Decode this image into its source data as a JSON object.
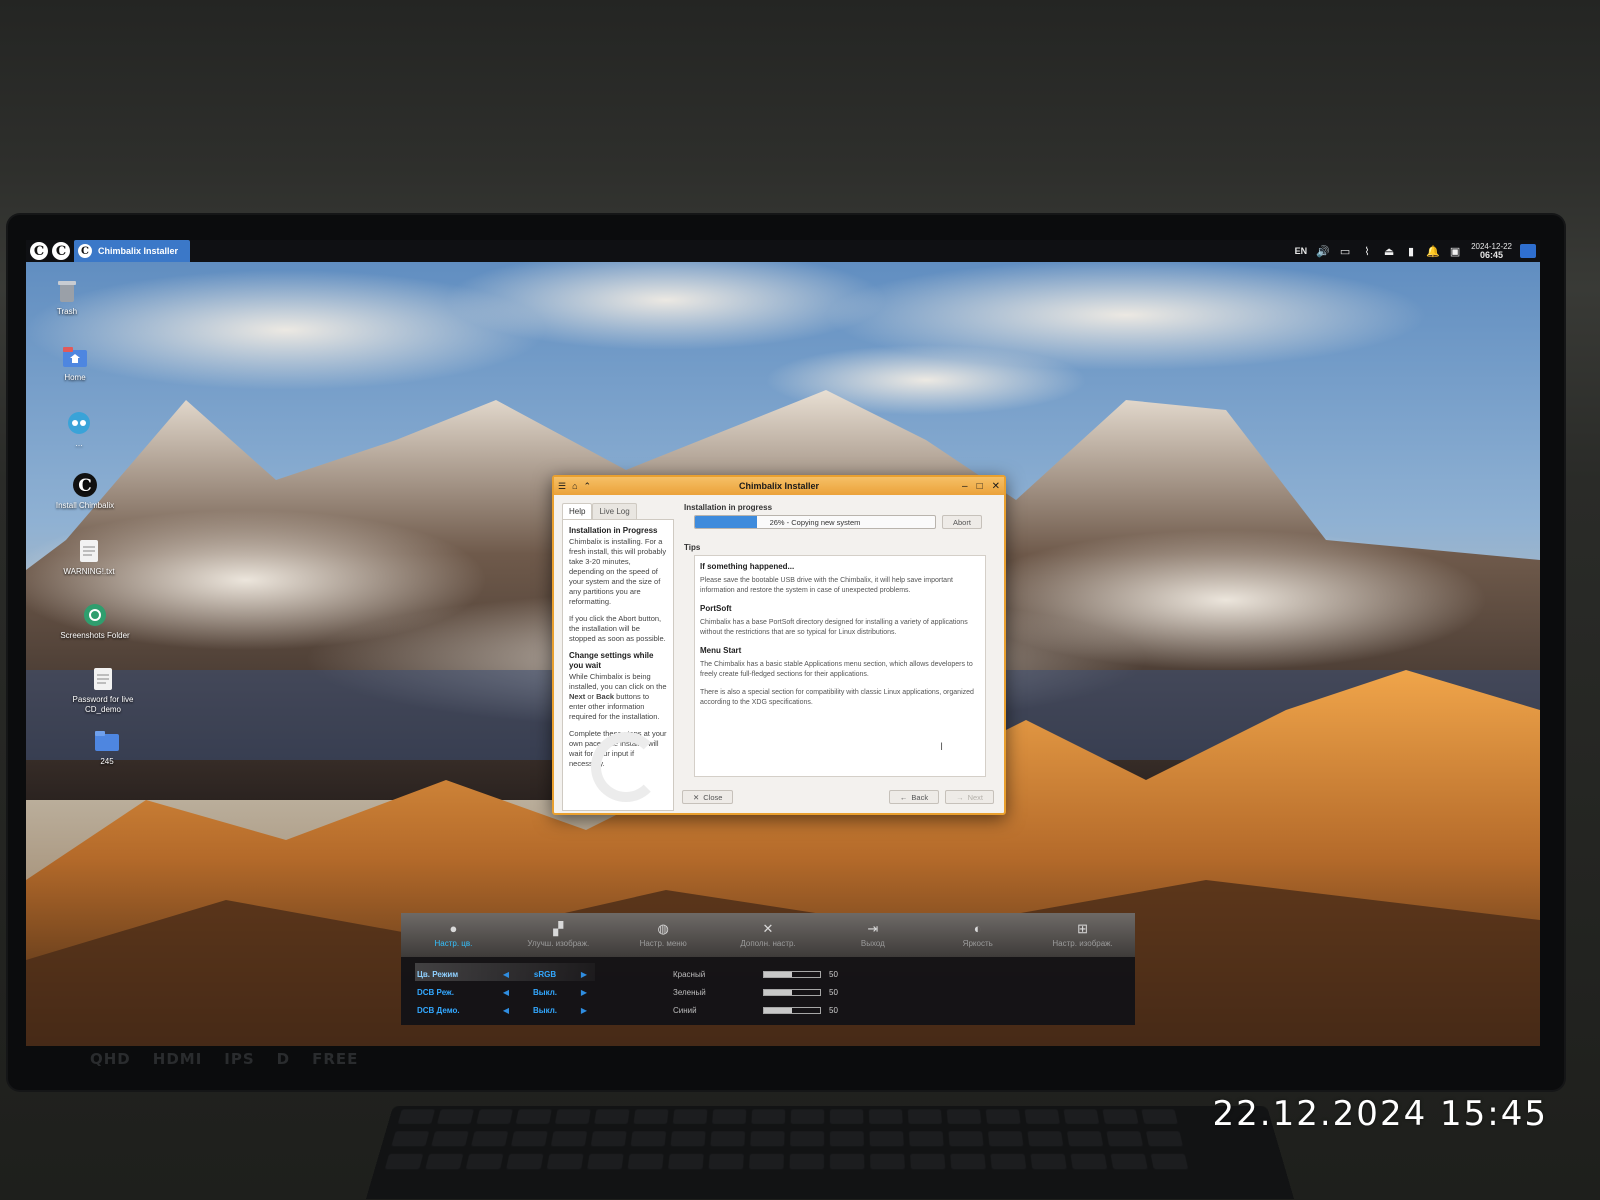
{
  "taskbar": {
    "active_window_label": "Chimbalix Installer",
    "tray": {
      "language": "EN",
      "date": "2024-12-22",
      "time": "06:45",
      "icons": [
        "volume-icon",
        "display-icon",
        "clip-icon",
        "eject-icon",
        "battery-icon",
        "notification-bell-icon",
        "screen-icon"
      ]
    }
  },
  "desktop_icons": [
    {
      "name": "trash-icon",
      "label": "Trash"
    },
    {
      "name": "home-folder-icon",
      "label": "Home"
    },
    {
      "name": "…"
    },
    {
      "name": "chimbalix-logo-icon",
      "label": "Install Chimbalix"
    },
    {
      "name": "document-icon",
      "label": "WARNING!.txt"
    },
    {
      "name": "screenshots-icon",
      "label": "Screenshots Folder"
    },
    {
      "name": "document-icon",
      "label": "Password for live CD_demo"
    },
    {
      "name": "folder-icon",
      "label": "245"
    }
  ],
  "installer": {
    "title": "Chimbalix Installer",
    "tabs": [
      "Help",
      "Live Log"
    ],
    "active_tab": "Help",
    "help": {
      "heading_1": "Installation in Progress",
      "para_1": "Chimbalix is installing. For a fresh install, this will probably take 3-20 minutes, depending on the speed of your system and the size of any partitions you are reformatting.",
      "para_2": "If you click the Abort button, the installation will be stopped as soon as possible.",
      "heading_2": "Change settings while you wait",
      "para_3a": "While Chimbalix is being installed, you can click on the",
      "para_3_next": "Next",
      "para_3_or": "or",
      "para_3_back": "Back",
      "para_3b": "buttons to enter other information required for the installation.",
      "para_4": "Complete these steps at your own pace. The installer will wait for your input if necessary."
    },
    "progress": {
      "label": "Installation in progress",
      "percent": 26,
      "text": "26% - Copying new system",
      "abort_label": "Abort"
    },
    "tips": {
      "label": "Tips",
      "h1": "If something happened...",
      "p1": "Please save the bootable USB drive with the Chimbalix, it will help save important information and restore the system in case of unexpected problems.",
      "h2": "PortSoft",
      "p2": "Chimbalix has a base PortSoft directory designed for installing a variety of applications without the restrictions that are so typical for Linux distributions.",
      "h3": "Menu Start",
      "p3": "The Chimbalix has a basic stable Applications menu section, which allows developers to freely create full-fledged sections for their applications.",
      "p4": "There is also a special section for compatibility with classic Linux applications, organized according to the XDG specifications."
    },
    "buttons": {
      "close": "Close",
      "back": "Back",
      "next": "Next"
    }
  },
  "osd": {
    "tabs": [
      {
        "icon": "color-balls-icon",
        "label": "Настр. цв."
      },
      {
        "icon": "picture-icon",
        "label": "Улучш. изображ."
      },
      {
        "icon": "globe-icon",
        "label": "Настр. меню"
      },
      {
        "icon": "tools-icon",
        "label": "Дополн. настр."
      },
      {
        "icon": "exit-icon",
        "label": "Выход"
      },
      {
        "icon": "brightness-icon",
        "label": "Яркость"
      },
      {
        "icon": "picture-add-icon",
        "label": "Настр. изображ."
      }
    ],
    "active_tab": 0,
    "settings": [
      {
        "name": "Цв. Режим",
        "value": "sRGB"
      },
      {
        "name": "DCB Реж.",
        "value": "Выкл."
      },
      {
        "name": "DCB Демо.",
        "value": "Выкл."
      }
    ],
    "channels": [
      {
        "name": "Красный",
        "value": 50
      },
      {
        "name": "Зеленый",
        "value": 50
      },
      {
        "name": "Синий",
        "value": 50
      }
    ]
  },
  "monitor_badges": [
    "QHD",
    "HDMI",
    "IPS",
    "D",
    "FREE"
  ],
  "photo_timestamp": "22.12.2024 15:45",
  "colors": {
    "accent": "#3e8bdc",
    "window_border": "#e9a02f",
    "osd_highlight": "#33c1ff"
  }
}
